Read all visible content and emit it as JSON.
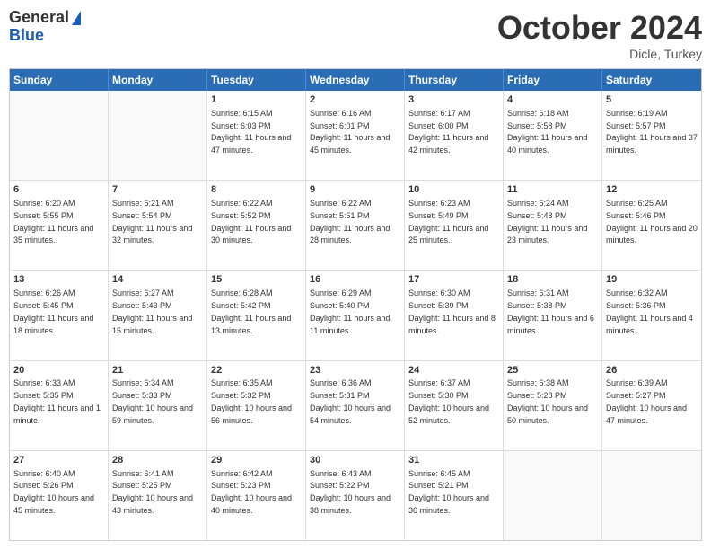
{
  "header": {
    "logo_general": "General",
    "logo_blue": "Blue",
    "month_title": "October 2024",
    "subtitle": "Dicle, Turkey"
  },
  "calendar": {
    "days": [
      "Sunday",
      "Monday",
      "Tuesday",
      "Wednesday",
      "Thursday",
      "Friday",
      "Saturday"
    ],
    "weeks": [
      [
        {
          "day": "",
          "empty": true
        },
        {
          "day": "",
          "empty": true
        },
        {
          "day": "1",
          "sunrise": "Sunrise: 6:15 AM",
          "sunset": "Sunset: 6:03 PM",
          "daylight": "Daylight: 11 hours and 47 minutes."
        },
        {
          "day": "2",
          "sunrise": "Sunrise: 6:16 AM",
          "sunset": "Sunset: 6:01 PM",
          "daylight": "Daylight: 11 hours and 45 minutes."
        },
        {
          "day": "3",
          "sunrise": "Sunrise: 6:17 AM",
          "sunset": "Sunset: 6:00 PM",
          "daylight": "Daylight: 11 hours and 42 minutes."
        },
        {
          "day": "4",
          "sunrise": "Sunrise: 6:18 AM",
          "sunset": "Sunset: 5:58 PM",
          "daylight": "Daylight: 11 hours and 40 minutes."
        },
        {
          "day": "5",
          "sunrise": "Sunrise: 6:19 AM",
          "sunset": "Sunset: 5:57 PM",
          "daylight": "Daylight: 11 hours and 37 minutes."
        }
      ],
      [
        {
          "day": "6",
          "sunrise": "Sunrise: 6:20 AM",
          "sunset": "Sunset: 5:55 PM",
          "daylight": "Daylight: 11 hours and 35 minutes."
        },
        {
          "day": "7",
          "sunrise": "Sunrise: 6:21 AM",
          "sunset": "Sunset: 5:54 PM",
          "daylight": "Daylight: 11 hours and 32 minutes."
        },
        {
          "day": "8",
          "sunrise": "Sunrise: 6:22 AM",
          "sunset": "Sunset: 5:52 PM",
          "daylight": "Daylight: 11 hours and 30 minutes."
        },
        {
          "day": "9",
          "sunrise": "Sunrise: 6:22 AM",
          "sunset": "Sunset: 5:51 PM",
          "daylight": "Daylight: 11 hours and 28 minutes."
        },
        {
          "day": "10",
          "sunrise": "Sunrise: 6:23 AM",
          "sunset": "Sunset: 5:49 PM",
          "daylight": "Daylight: 11 hours and 25 minutes."
        },
        {
          "day": "11",
          "sunrise": "Sunrise: 6:24 AM",
          "sunset": "Sunset: 5:48 PM",
          "daylight": "Daylight: 11 hours and 23 minutes."
        },
        {
          "day": "12",
          "sunrise": "Sunrise: 6:25 AM",
          "sunset": "Sunset: 5:46 PM",
          "daylight": "Daylight: 11 hours and 20 minutes."
        }
      ],
      [
        {
          "day": "13",
          "sunrise": "Sunrise: 6:26 AM",
          "sunset": "Sunset: 5:45 PM",
          "daylight": "Daylight: 11 hours and 18 minutes."
        },
        {
          "day": "14",
          "sunrise": "Sunrise: 6:27 AM",
          "sunset": "Sunset: 5:43 PM",
          "daylight": "Daylight: 11 hours and 15 minutes."
        },
        {
          "day": "15",
          "sunrise": "Sunrise: 6:28 AM",
          "sunset": "Sunset: 5:42 PM",
          "daylight": "Daylight: 11 hours and 13 minutes."
        },
        {
          "day": "16",
          "sunrise": "Sunrise: 6:29 AM",
          "sunset": "Sunset: 5:40 PM",
          "daylight": "Daylight: 11 hours and 11 minutes."
        },
        {
          "day": "17",
          "sunrise": "Sunrise: 6:30 AM",
          "sunset": "Sunset: 5:39 PM",
          "daylight": "Daylight: 11 hours and 8 minutes."
        },
        {
          "day": "18",
          "sunrise": "Sunrise: 6:31 AM",
          "sunset": "Sunset: 5:38 PM",
          "daylight": "Daylight: 11 hours and 6 minutes."
        },
        {
          "day": "19",
          "sunrise": "Sunrise: 6:32 AM",
          "sunset": "Sunset: 5:36 PM",
          "daylight": "Daylight: 11 hours and 4 minutes."
        }
      ],
      [
        {
          "day": "20",
          "sunrise": "Sunrise: 6:33 AM",
          "sunset": "Sunset: 5:35 PM",
          "daylight": "Daylight: 11 hours and 1 minute."
        },
        {
          "day": "21",
          "sunrise": "Sunrise: 6:34 AM",
          "sunset": "Sunset: 5:33 PM",
          "daylight": "Daylight: 10 hours and 59 minutes."
        },
        {
          "day": "22",
          "sunrise": "Sunrise: 6:35 AM",
          "sunset": "Sunset: 5:32 PM",
          "daylight": "Daylight: 10 hours and 56 minutes."
        },
        {
          "day": "23",
          "sunrise": "Sunrise: 6:36 AM",
          "sunset": "Sunset: 5:31 PM",
          "daylight": "Daylight: 10 hours and 54 minutes."
        },
        {
          "day": "24",
          "sunrise": "Sunrise: 6:37 AM",
          "sunset": "Sunset: 5:30 PM",
          "daylight": "Daylight: 10 hours and 52 minutes."
        },
        {
          "day": "25",
          "sunrise": "Sunrise: 6:38 AM",
          "sunset": "Sunset: 5:28 PM",
          "daylight": "Daylight: 10 hours and 50 minutes."
        },
        {
          "day": "26",
          "sunrise": "Sunrise: 6:39 AM",
          "sunset": "Sunset: 5:27 PM",
          "daylight": "Daylight: 10 hours and 47 minutes."
        }
      ],
      [
        {
          "day": "27",
          "sunrise": "Sunrise: 6:40 AM",
          "sunset": "Sunset: 5:26 PM",
          "daylight": "Daylight: 10 hours and 45 minutes."
        },
        {
          "day": "28",
          "sunrise": "Sunrise: 6:41 AM",
          "sunset": "Sunset: 5:25 PM",
          "daylight": "Daylight: 10 hours and 43 minutes."
        },
        {
          "day": "29",
          "sunrise": "Sunrise: 6:42 AM",
          "sunset": "Sunset: 5:23 PM",
          "daylight": "Daylight: 10 hours and 40 minutes."
        },
        {
          "day": "30",
          "sunrise": "Sunrise: 6:43 AM",
          "sunset": "Sunset: 5:22 PM",
          "daylight": "Daylight: 10 hours and 38 minutes."
        },
        {
          "day": "31",
          "sunrise": "Sunrise: 6:45 AM",
          "sunset": "Sunset: 5:21 PM",
          "daylight": "Daylight: 10 hours and 36 minutes."
        },
        {
          "day": "",
          "empty": true
        },
        {
          "day": "",
          "empty": true
        }
      ]
    ]
  }
}
